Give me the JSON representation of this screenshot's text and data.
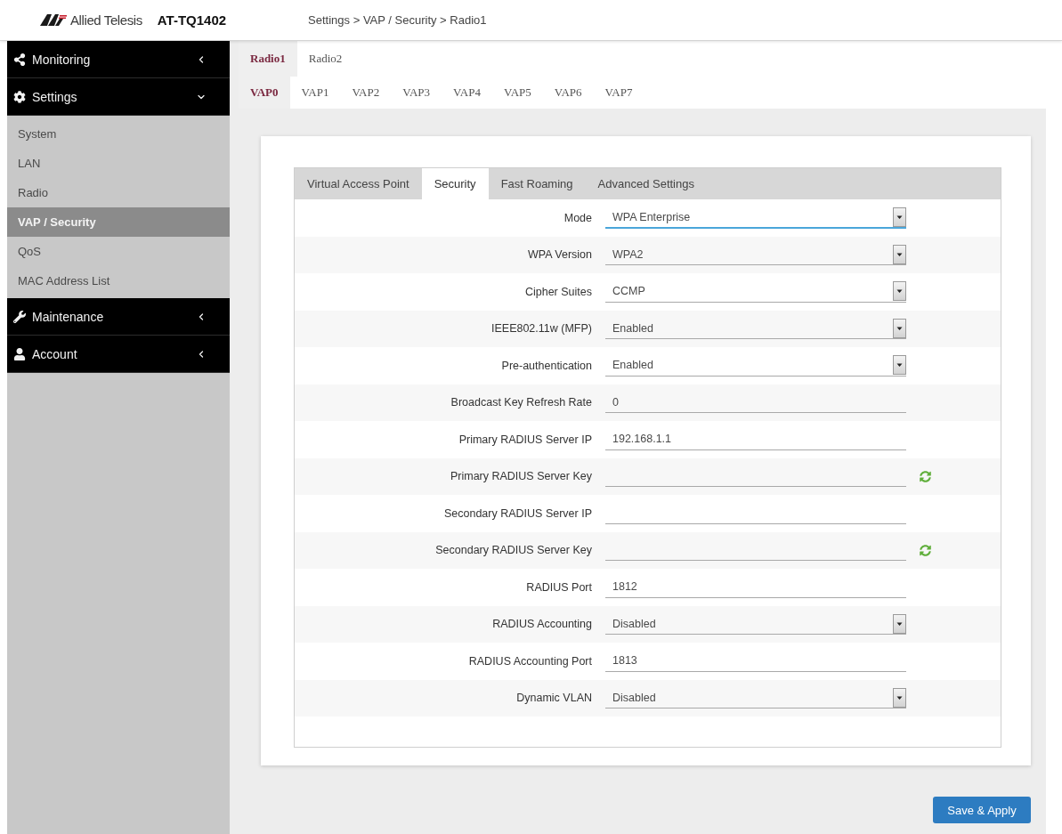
{
  "header": {
    "brand": "Allied Telesis",
    "model": "AT-TQ1402",
    "breadcrumb": "Settings > VAP / Security > Radio1"
  },
  "sidebar": {
    "sections": [
      {
        "label": "Monitoring",
        "expanded": false
      },
      {
        "label": "Settings",
        "expanded": true,
        "items": [
          {
            "label": "System",
            "selected": false
          },
          {
            "label": "LAN",
            "selected": false
          },
          {
            "label": "Radio",
            "selected": false
          },
          {
            "label": "VAP / Security",
            "selected": true
          },
          {
            "label": "QoS",
            "selected": false
          },
          {
            "label": "MAC Address List",
            "selected": false
          }
        ]
      },
      {
        "label": "Maintenance",
        "expanded": false
      },
      {
        "label": "Account",
        "expanded": false
      }
    ]
  },
  "radio_tabs": [
    {
      "label": "Radio1",
      "selected": true
    },
    {
      "label": "Radio2",
      "selected": false
    }
  ],
  "vap_tabs": [
    {
      "label": "VAP0",
      "selected": true
    },
    {
      "label": "VAP1",
      "selected": false
    },
    {
      "label": "VAP2",
      "selected": false
    },
    {
      "label": "VAP3",
      "selected": false
    },
    {
      "label": "VAP4",
      "selected": false
    },
    {
      "label": "VAP5",
      "selected": false
    },
    {
      "label": "VAP6",
      "selected": false
    },
    {
      "label": "VAP7",
      "selected": false
    }
  ],
  "section_tabs": [
    {
      "label": "Virtual Access Point",
      "selected": false
    },
    {
      "label": "Security",
      "selected": true
    },
    {
      "label": "Fast Roaming",
      "selected": false
    },
    {
      "label": "Advanced Settings",
      "selected": false
    }
  ],
  "form": {
    "rows": [
      {
        "label": "Mode",
        "kind": "select",
        "value": "WPA Enterprise",
        "focused": true
      },
      {
        "label": "WPA Version",
        "kind": "select",
        "value": "WPA2",
        "focused": false
      },
      {
        "label": "Cipher Suites",
        "kind": "select",
        "value": "CCMP",
        "focused": false
      },
      {
        "label": "IEEE802.11w (MFP)",
        "kind": "select",
        "value": "Enabled",
        "focused": false
      },
      {
        "label": "Pre-authentication",
        "kind": "select",
        "value": "Enabled",
        "focused": false
      },
      {
        "label": "Broadcast Key Refresh Rate",
        "kind": "text",
        "value": "0",
        "focused": false
      },
      {
        "label": "Primary RADIUS Server IP",
        "kind": "text",
        "value": "192.168.1.1",
        "focused": false
      },
      {
        "label": "Primary RADIUS Server Key",
        "kind": "key",
        "focused": false
      },
      {
        "label": "Secondary RADIUS Server IP",
        "kind": "text",
        "focused": false
      },
      {
        "label": "Secondary RADIUS Server Key",
        "kind": "key",
        "focused": false
      },
      {
        "label": "RADIUS Port",
        "kind": "text",
        "value": "1812",
        "focused": false
      },
      {
        "label": "RADIUS Accounting",
        "kind": "select",
        "value": "Disabled",
        "focused": false
      },
      {
        "label": "RADIUS Accounting Port",
        "kind": "text",
        "value": "1813",
        "focused": false
      },
      {
        "label": "Dynamic VLAN",
        "kind": "select",
        "value": "Disabled",
        "focused": false
      }
    ]
  },
  "save_button": {
    "label": "Save & Apply"
  }
}
